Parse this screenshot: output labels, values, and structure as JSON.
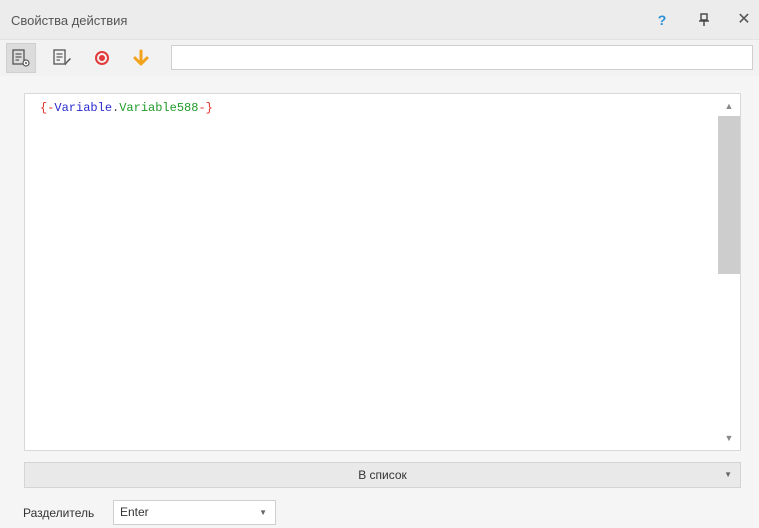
{
  "window": {
    "title": "Свойства действия",
    "help_label": "?",
    "pin_label": "⊥",
    "close_label": "✕"
  },
  "toolbar": {
    "icons": [
      "list-settings-icon",
      "list-edit-icon",
      "record-icon",
      "down-arrow-icon"
    ],
    "search_value": ""
  },
  "editor": {
    "open_brace": "{-",
    "var_keyword": "Variable",
    "dot": ".",
    "var_name": "Variable588",
    "close_brace": "-}"
  },
  "action_select": {
    "value": "В список"
  },
  "separator": {
    "label": "Разделитель",
    "value": "Enter"
  },
  "colors": {
    "brace": "#e0312b",
    "keyword": "#2a2acf",
    "name": "#1f9a2a",
    "record": "#e33b3b",
    "arrow": "#f2a31b",
    "help": "#2b8fd6"
  }
}
